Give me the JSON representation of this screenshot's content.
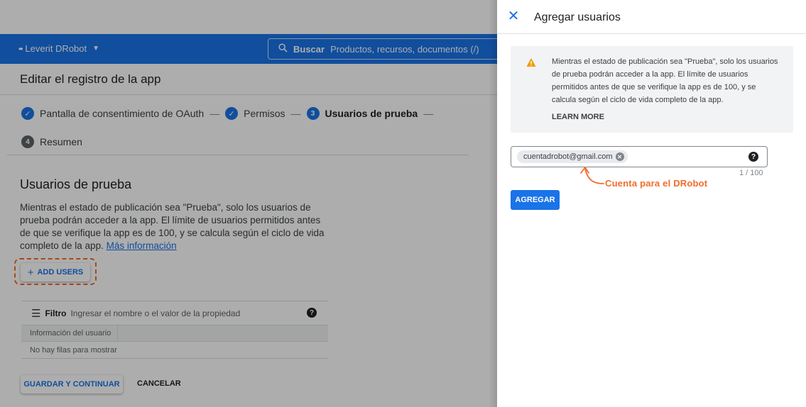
{
  "background_page": {
    "project_name": "Leverit DRobot",
    "search": {
      "label": "Buscar",
      "placeholder": "Productos, recursos, documentos (/)"
    },
    "page_title": "Editar el registro de la app",
    "steps": [
      {
        "label": "Pantalla de consentimiento de OAuth",
        "state": "done"
      },
      {
        "label": "Permisos",
        "state": "done"
      },
      {
        "number": "3",
        "label": "Usuarios de prueba",
        "state": "active"
      },
      {
        "number": "4",
        "label": "Resumen",
        "state": "pending"
      }
    ],
    "step_separator": "—",
    "section_title": "Usuarios de prueba",
    "section_desc": "Mientras el estado de publicación sea \"Prueba\", solo los usuarios de prueba podrán acceder a la app. El límite de usuarios permitidos antes de que se verifique la app es de 100, y se calcula según el ciclo de vida completo de la app.",
    "more_info_link": "Más información",
    "add_users_button": "ADD USERS",
    "filter": {
      "label": "Filtro",
      "placeholder": "Ingresar el nombre o el valor de la propiedad"
    },
    "table": {
      "columns": [
        "Información del usuario"
      ],
      "empty_text": "No hay filas para mostrar"
    },
    "save_button": "GUARDAR Y CONTINUAR",
    "cancel_button": "CANCELAR"
  },
  "panel": {
    "title": "Agregar usuarios",
    "warning_text": "Mientras el estado de publicación sea \"Prueba\", solo los usuarios de prueba podrán acceder a la app. El límite de usuarios permitidos antes de que se verifique la app es de 100, y se calcula según el ciclo de vida completo de la app.",
    "learn_more": "LEARN MORE",
    "email_chip": "cuentadrobot@gmail.com",
    "counter": "1 / 100",
    "annotation": "Cuenta para el DRobot",
    "add_button": "AGREGAR"
  },
  "colors": {
    "accent": "#1a73e8",
    "annotation": "#f26c2b",
    "warning": "#f29900"
  }
}
